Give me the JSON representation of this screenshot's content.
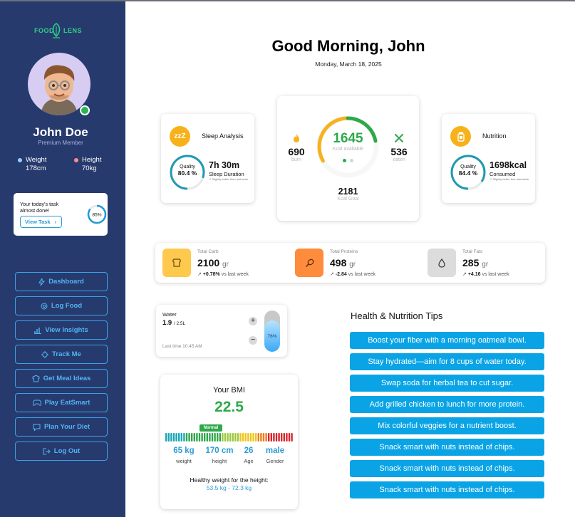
{
  "app": {
    "logo_left": "FOOD",
    "logo_right": "LENS"
  },
  "profile": {
    "name": "John Doe",
    "tier": "Premium Member",
    "weight_label": "Weight",
    "weight_value": "178cm",
    "height_label": "Height",
    "height_value": "70kg",
    "online": true,
    "colors": {
      "weight_dot": "#8fd0ff",
      "height_dot": "#ff8c8c",
      "online": "#2ab54f"
    }
  },
  "task": {
    "text": "Your today's task almost done!",
    "button_label": "View Task",
    "progress_percent": 85,
    "progress_label": "85%"
  },
  "nav": [
    {
      "label": "Dashboard",
      "icon": "lightning-icon"
    },
    {
      "label": "Log Food",
      "icon": "target-icon"
    },
    {
      "label": "View Insights",
      "icon": "bar-chart-icon"
    },
    {
      "label": "Track Me",
      "icon": "crosshair-icon"
    },
    {
      "label": "Get Meal Ideas",
      "icon": "chef-hat-icon"
    },
    {
      "label": "Play EatSmart",
      "icon": "gamepad-icon"
    },
    {
      "label": "Plan Your Diet",
      "icon": "chat-icon"
    },
    {
      "label": "Log Out",
      "icon": "logout-icon"
    }
  ],
  "header": {
    "greeting": "Good Morning, John",
    "date": "Monday, March 18, 2025"
  },
  "sleep": {
    "title": "Sleep Analysis",
    "icon_text": "zzZ",
    "quality_label": "Quality",
    "quality_value": "80.4 %",
    "quality_fraction": 0.804,
    "duration": "7h 30m",
    "duration_label": "Sleep Duration",
    "note": "Slightly better than last week"
  },
  "calories": {
    "available": "1645",
    "available_label": "Kcal available",
    "burn": "690",
    "burn_label": "burn",
    "eaten": "536",
    "eaten_label": "eaten",
    "goal": "2181",
    "goal_label": "Kcal Goal",
    "colors": {
      "primary": "#2ea84a",
      "burn": "#f7b21b",
      "eaten": "#2ea84a"
    }
  },
  "nutrition": {
    "title": "Nutrition",
    "quality_label": "Quality",
    "quality_value": "84.4 %",
    "quality_fraction": 0.844,
    "consumed": "1698kcal",
    "consumed_label": "Consumed",
    "note": "Slightly better than last week"
  },
  "macros": [
    {
      "label": "Total Carb",
      "value": "2100",
      "unit": "gr",
      "trend": "+0.78%",
      "trend_suffix": "vs last week",
      "color": "#ffc94e",
      "icon": "bread-icon"
    },
    {
      "label": "Total Proteins",
      "value": "498",
      "unit": "gr",
      "trend": "-2.84",
      "trend_suffix": "vs last week",
      "color": "#ff8b3d",
      "icon": "drumstick-icon"
    },
    {
      "label": "Total Fats",
      "value": "285",
      "unit": "gr",
      "trend": "+4.16",
      "trend_suffix": "vs last week",
      "color": "#dcdcdc",
      "icon": "drop-icon"
    }
  ],
  "water": {
    "title": "Water",
    "value": "1.9",
    "unit": "/ 2.5L",
    "last_time": "Last time 10:45 AM",
    "percent": 76,
    "percent_label": "76%"
  },
  "bmi": {
    "title": "Your BMI",
    "value": "22.5",
    "status": "Normal",
    "weight": "65 kg",
    "weight_label": "weight",
    "height": "170 cm",
    "height_label": "height",
    "age": "26",
    "age_label": "Age",
    "gender": "male",
    "gender_label": "Gender",
    "healthy_label": "Healthy weight for the height:",
    "healthy_range": "53.5 kg - 72.3 kg"
  },
  "tips": {
    "title": "Health & Nutrition Tips",
    "items": [
      "Boost your fiber with a morning oatmeal bowl.",
      "Stay hydrated—aim for 8 cups of water today.",
      "Swap soda for herbal tea to cut sugar.",
      "Add grilled chicken to lunch for more protein.",
      "Mix colorful veggies for a nutrient boost.",
      "Snack smart with nuts instead of chips.",
      "Snack smart with nuts instead of chips.",
      "Snack smart with nuts instead of chips."
    ]
  }
}
